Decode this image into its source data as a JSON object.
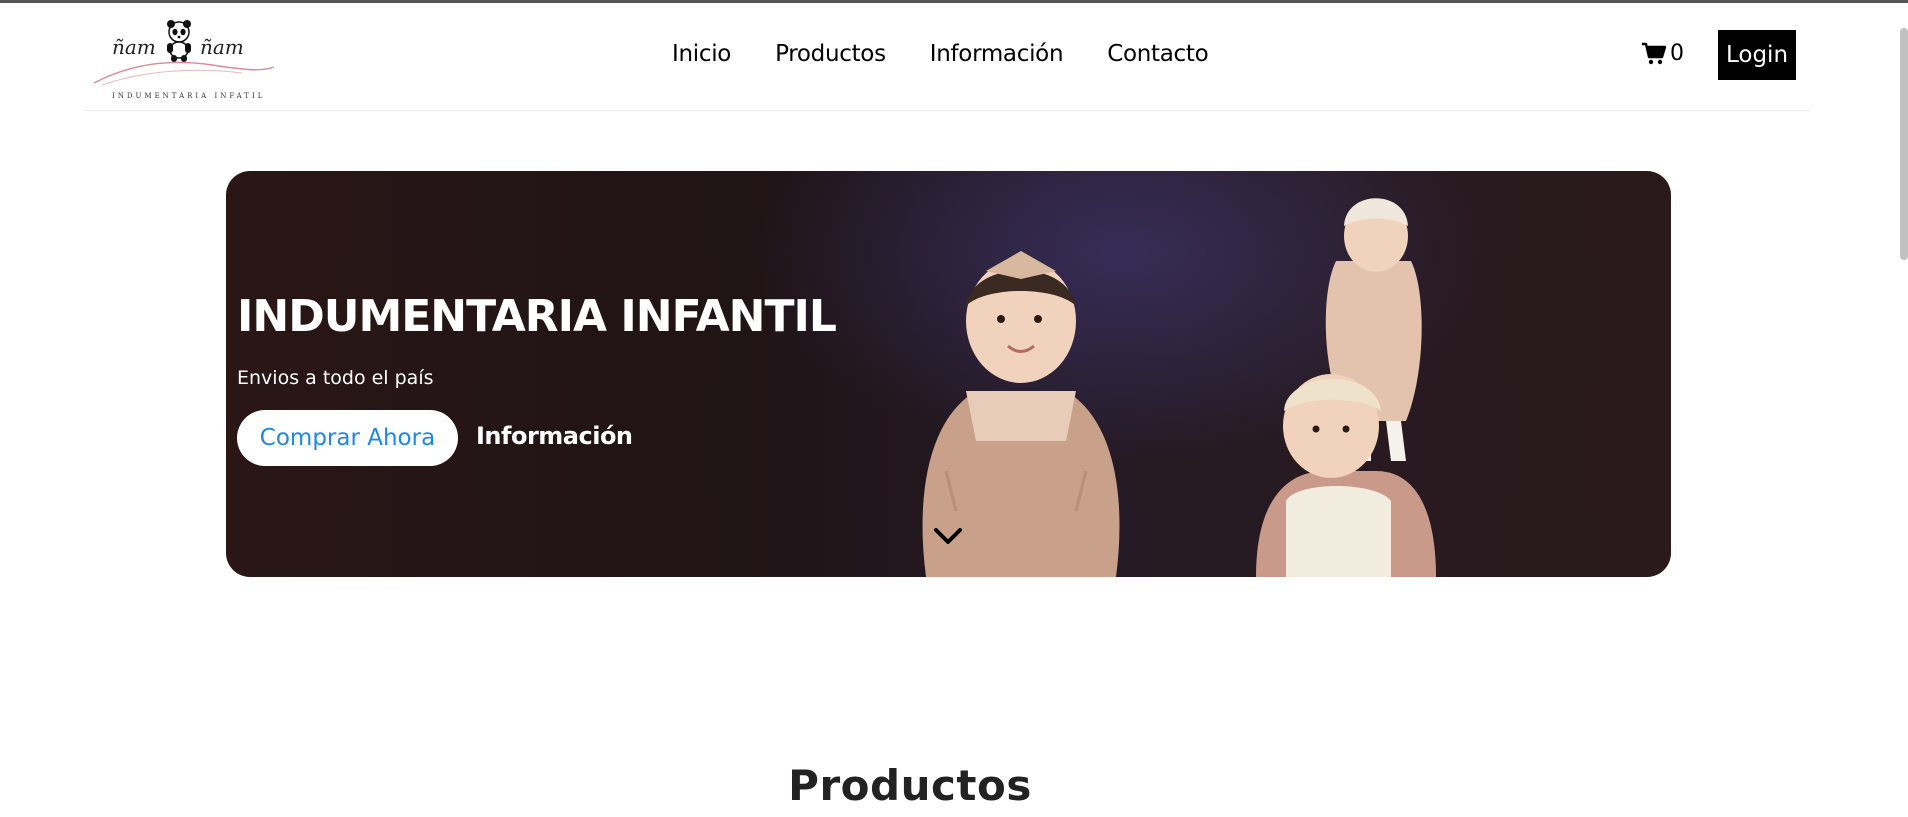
{
  "brand": {
    "logo_word_left": "ñam",
    "logo_word_right": "ñam",
    "logo_subtitle": "INDUMENTARIA INFATIL",
    "logo_icon": "panda-icon"
  },
  "nav": {
    "items": [
      {
        "label": "Inicio"
      },
      {
        "label": "Productos"
      },
      {
        "label": "Información"
      },
      {
        "label": "Contacto"
      }
    ]
  },
  "cart": {
    "icon": "cart-icon",
    "count": "0"
  },
  "auth": {
    "login_label": "Login"
  },
  "hero": {
    "title": "INDUMENTARIA INFANTIL",
    "subtitle": "Envios a todo el país",
    "primary_button": "Comprar Ahora",
    "secondary_link": "Información",
    "scroll_icon": "chevron-down-icon"
  },
  "section": {
    "title": "Productos"
  },
  "colors": {
    "accent_blue": "#1e88e5",
    "login_bg": "#000000",
    "hero_bg": "#221518"
  }
}
